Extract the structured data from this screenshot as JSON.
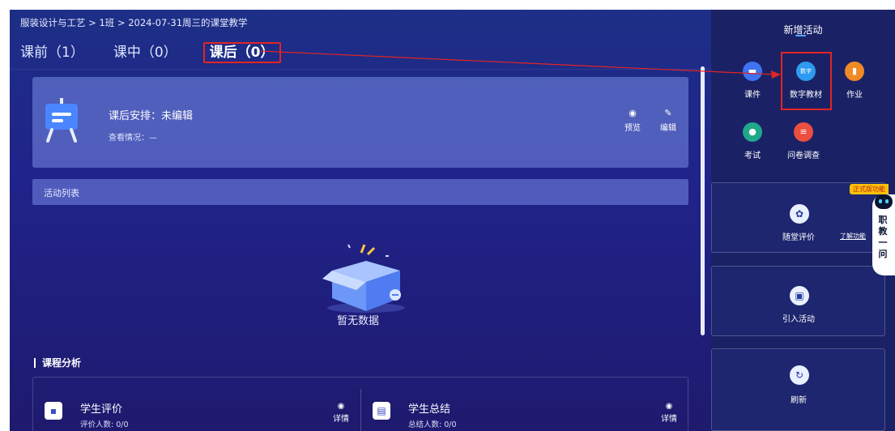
{
  "breadcrumb": "服装设计与工艺 > 1班 > 2024-07-31周三的课堂教学",
  "tabs": [
    {
      "label": "课前（1）"
    },
    {
      "label": "课中（0）"
    },
    {
      "label": "课后（0）"
    }
  ],
  "arrange": {
    "title": "课后安排：未编辑",
    "sub": "查看情况：—",
    "preview": "预览",
    "edit": "编辑"
  },
  "activity_list": "活动列表",
  "empty": "暂无数据",
  "analysis": {
    "title": "课程分析",
    "eval_title": "学生评价",
    "eval_sub": "评价人数: 0/0",
    "eval_detail": "详情",
    "sum_title": "学生总结",
    "sum_sub": "总结人数: 0/0",
    "sum_detail": "详情"
  },
  "side": {
    "title": "新增活动",
    "tools": [
      {
        "label": "课件",
        "icon": "courseware-icon",
        "color": "#3f73f2"
      },
      {
        "label": "数字教材",
        "icon": "digital-textbook-icon",
        "color": "#2d9bf0"
      },
      {
        "label": "作业",
        "icon": "homework-icon",
        "color": "#f08a24"
      },
      {
        "label": "考试",
        "icon": "exam-icon",
        "color": "#1fa88a"
      },
      {
        "label": "问卷调查",
        "icon": "survey-icon",
        "color": "#ea4f40"
      }
    ],
    "classroom_eval": "随堂评价",
    "learn_more": "了解功能",
    "import": "引入活动",
    "refresh": "刷新",
    "digital_badge": "数字"
  },
  "robot": {
    "badge": "正式版功能",
    "text": "职教一问"
  },
  "colors": {
    "accent_red": "#e32424",
    "bg_main": "#20238a",
    "side_bg": "#1a2265"
  }
}
